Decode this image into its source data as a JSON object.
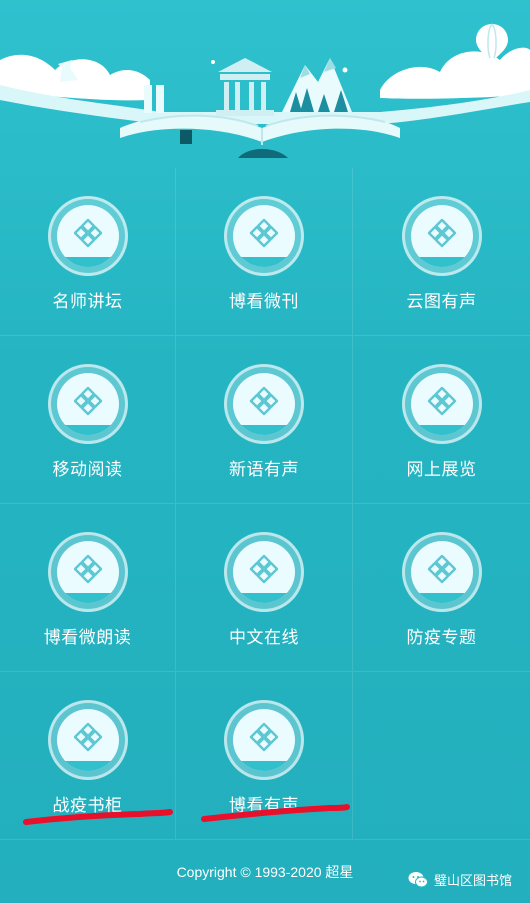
{
  "footer": {
    "copyright": "Copyright © 1993-2020 超星",
    "watermark": "璧山区图书馆"
  },
  "grid": {
    "items": [
      {
        "label": "名师讲坛"
      },
      {
        "label": "博看微刊"
      },
      {
        "label": "云图有声"
      },
      {
        "label": "移动阅读"
      },
      {
        "label": "新语有声"
      },
      {
        "label": "网上展览"
      },
      {
        "label": "博看微朗读"
      },
      {
        "label": "中文在线"
      },
      {
        "label": "防疫专题"
      },
      {
        "label": "战疫书柜"
      },
      {
        "label": "博看有声"
      }
    ]
  },
  "colors": {
    "background": "#27b9c6",
    "accent": "#5ec7d2",
    "underline": "#e8102a"
  },
  "icons": {
    "module": "diamond-grid-icon",
    "balloon": "hot-air-balloon-icon",
    "wechat": "wechat-icon"
  }
}
